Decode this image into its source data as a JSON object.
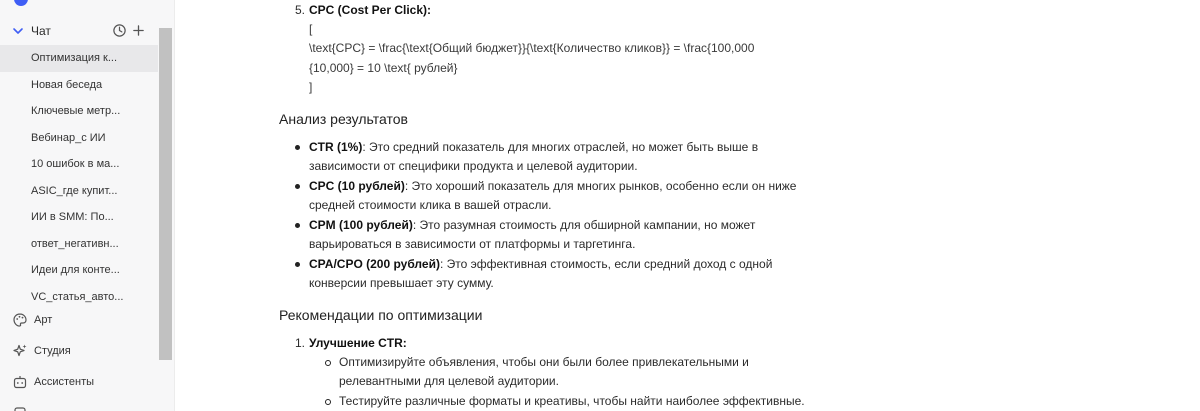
{
  "sidebar": {
    "chat_section": {
      "label": "Чат",
      "expanded": true
    },
    "chats": [
      "Оптимизация к...",
      "Новая беседа",
      "Ключевые метр...",
      "Вебинар_с ИИ",
      "10 ошибок в ма...",
      "ASIC_где купит...",
      "ИИ в SMM: По...",
      "ответ_негативн...",
      "Идеи для конте...",
      "VC_статья_авто..."
    ],
    "active_chat_index": 0,
    "nav": [
      {
        "label": "Арт",
        "icon": "palette-icon"
      },
      {
        "label": "Студия",
        "icon": "sparkle-icon"
      },
      {
        "label": "Ассистенты",
        "icon": "bot-icon"
      }
    ],
    "accent_color": "#3f5ef5"
  },
  "content": {
    "cpc_item": {
      "number": "5.",
      "title": "CPC (Cost Per Click):",
      "latex_open": "[",
      "latex_line1": "\\text{CPC} = \\frac{\\text{Общий бюджет}}{\\text{Количество кликов}} = \\frac{100,000",
      "latex_line2": "{10,000} = 10 \\text{ рублей}",
      "latex_close": "]"
    },
    "analysis": {
      "heading": "Анализ результатов",
      "items": [
        {
          "term": "CTR (1%)",
          "line1": ": Это средний показатель для многих отраслей, но может быть выше в",
          "line2": "зависимости от специфики продукта и целевой аудитории."
        },
        {
          "term": "CPC (10 рублей)",
          "line1": ": Это хороший показатель для многих рынков, особенно если он ниже",
          "line2": "средней стоимости клика в вашей отрасли."
        },
        {
          "term": "CPM (100 рублей)",
          "line1": ": Это разумная стоимость для обширной кампании, но может",
          "line2": "варьироваться в зависимости от платформы и таргетинга."
        },
        {
          "term": "CPA/CPO (200 рублей)",
          "line1": ": Это эффективная стоимость, если средний доход с одной",
          "line2": "конверсии превышает эту сумму."
        }
      ]
    },
    "recommendations": {
      "heading": "Рекомендации по оптимизации",
      "item1": {
        "number": "1.",
        "title": "Улучшение CTR:",
        "sub1_line1": "Оптимизируйте объявления, чтобы они были более привлекательными и",
        "sub1_line2": "релевантными для целевой аудитории.",
        "sub2_line1": "Тестируйте различные форматы и креативы, чтобы найти наиболее эффективные."
      }
    }
  }
}
